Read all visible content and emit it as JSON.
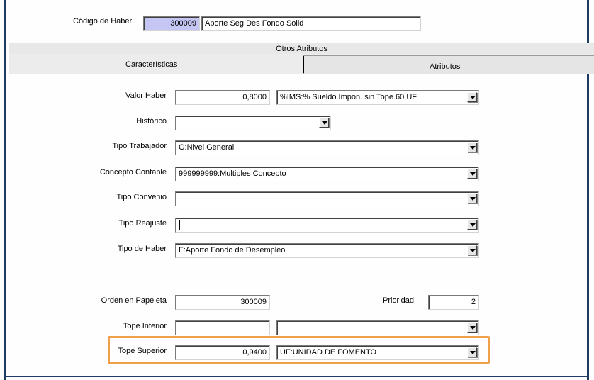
{
  "header": {
    "codigo_label": "Código de Haber",
    "codigo_value": "300009",
    "codigo_desc": "Aporte Seg Des Fondo Solid"
  },
  "tabs": {
    "group_title": "Otros Atributos",
    "caracteristicas": "Características",
    "atributos": "Atributos"
  },
  "form": {
    "valor_haber": {
      "label": "Valor Haber",
      "value": "0,8000",
      "combo": "%IMS:% Sueldo Impon. sin Tope 60 UF"
    },
    "historico": {
      "label": "Histórico",
      "combo": ""
    },
    "tipo_trabajador": {
      "label": "Tipo Trabajador",
      "combo": "G:Nivel General"
    },
    "concepto_contable": {
      "label": "Concepto Contable",
      "combo": "999999999:Multiples Concepto"
    },
    "tipo_convenio": {
      "label": "Tipo Convenio",
      "combo": ""
    },
    "tipo_reajuste": {
      "label": "Tipo Reajuste",
      "combo": ""
    },
    "tipo_haber": {
      "label": "Tipo de Haber",
      "combo": "F:Aporte Fondo de Desempleo"
    },
    "orden_papeleta": {
      "label": "Orden en Papeleta",
      "value": "300009"
    },
    "prioridad": {
      "label": "Prioridad",
      "value": "2"
    },
    "tope_inferior": {
      "label": "Tope Inferior",
      "value": "",
      "combo": ""
    },
    "tope_superior": {
      "label": "Tope Superior",
      "value": "0,9400",
      "combo": "UF:UNIDAD DE FOMENTO"
    }
  },
  "colors": {
    "highlight": "#f0a04b",
    "code_field": "#c6c6f4",
    "frame": "#1f3b63"
  }
}
